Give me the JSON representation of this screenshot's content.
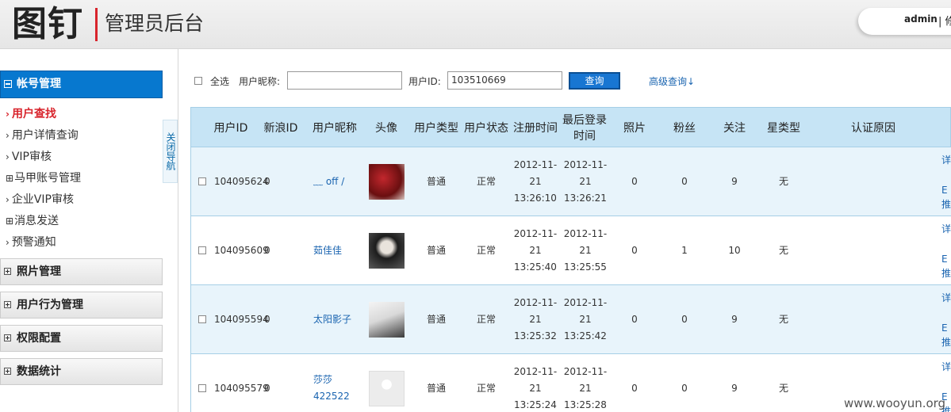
{
  "header": {
    "logo": "图钉",
    "title": "管理员后台",
    "username": "admin",
    "user_menu_partial": "| 修"
  },
  "sidebar": {
    "active_group": "帐号管理",
    "items": [
      {
        "label": "用户查找",
        "prefix": "›",
        "current": true
      },
      {
        "label": "用户详情查询",
        "prefix": "›"
      },
      {
        "label": "VIP审核",
        "prefix": "›"
      },
      {
        "label": "马甲账号管理",
        "prefix": "⊞"
      },
      {
        "label": "企业VIP审核",
        "prefix": "›"
      },
      {
        "label": "消息发送",
        "prefix": "⊞"
      },
      {
        "label": "预警通知",
        "prefix": "›"
      }
    ],
    "groups": [
      "照片管理",
      "用户行为管理",
      "权限配置",
      "数据统计"
    ],
    "close_nav": "关闭导航"
  },
  "search": {
    "select_all": "全选",
    "nickname_label": "用户昵称:",
    "nickname_value": "",
    "userid_label": "用户ID:",
    "userid_value": "103510669",
    "query_button": "查询",
    "advanced_link": "高级查询↓"
  },
  "table": {
    "columns": [
      "用户ID",
      "新浪ID",
      "用户昵称",
      "头像",
      "用户类型",
      "用户状态",
      "注册时间",
      "最后登录时间",
      "照片",
      "粉丝",
      "关注",
      "星类型",
      "认证原因"
    ],
    "rows": [
      {
        "id": "104095624",
        "sina_id": "0",
        "nickname": "﹏ off /",
        "avatar": "avatar-red",
        "type": "普通",
        "status": "正常",
        "reg_time": "2012-11-21 13:26:10",
        "last_login": "2012-11-21 13:26:21",
        "photos": "0",
        "fans": "0",
        "follows": "9",
        "star": "无",
        "reason": ""
      },
      {
        "id": "104095609",
        "sina_id": "0",
        "nickname": "茹佳佳",
        "avatar": "avatar-girl",
        "type": "普通",
        "status": "正常",
        "reg_time": "2012-11-21 13:25:40",
        "last_login": "2012-11-21 13:25:55",
        "photos": "0",
        "fans": "1",
        "follows": "10",
        "star": "无",
        "reason": ""
      },
      {
        "id": "104095594",
        "sina_id": "0",
        "nickname": "太阳影子",
        "avatar": "avatar-note",
        "type": "普通",
        "status": "正常",
        "reg_time": "2012-11-21 13:25:32",
        "last_login": "2012-11-21 13:25:42",
        "photos": "0",
        "fans": "0",
        "follows": "9",
        "star": "无",
        "reason": ""
      },
      {
        "id": "104095579",
        "sina_id": "0",
        "nickname": "莎莎422522",
        "avatar": "avatar-default",
        "type": "普通",
        "status": "正常",
        "reg_time": "2012-11-21 13:25:24",
        "last_login": "2012-11-21 13:25:28",
        "photos": "0",
        "fans": "0",
        "follows": "9",
        "star": "无",
        "reason": ""
      }
    ],
    "row_actions_partial": [
      "详",
      "E",
      "推"
    ]
  },
  "watermark": "www.wooyun.org"
}
